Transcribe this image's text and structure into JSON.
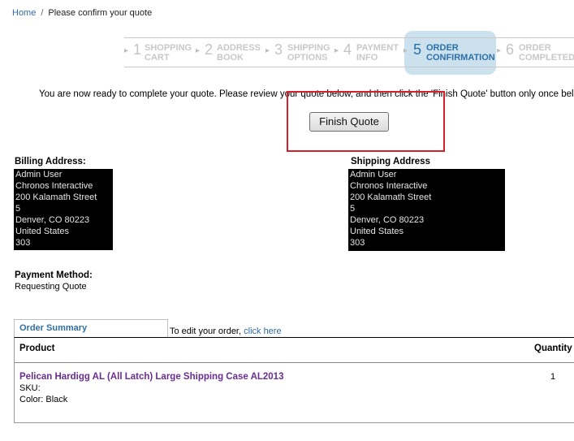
{
  "breadcrumb": {
    "home": "Home",
    "separator": "/",
    "current": "Please confirm your quote"
  },
  "steps": [
    {
      "num": "1",
      "line1": "SHOPPING",
      "line2": "CART"
    },
    {
      "num": "2",
      "line1": "ADDRESS",
      "line2": "BOOK"
    },
    {
      "num": "3",
      "line1": "SHIPPING",
      "line2": "OPTIONS"
    },
    {
      "num": "4",
      "line1": "PAYMENT",
      "line2": "INFO"
    },
    {
      "num": "5",
      "line1": "ORDER",
      "line2": "CONFIRMATION",
      "active": true
    },
    {
      "num": "6",
      "line1": "ORDER",
      "line2": "COMPLETED"
    }
  ],
  "intro_text": "You are now ready to complete your quote. Please review your quote below, and then click the 'Finish Quote' button only once below to p",
  "finish_button": "Finish Quote",
  "billing": {
    "title": "Billing Address:",
    "lines": [
      "Admin User",
      "Chronos Interactive",
      "200 Kalamath Street",
      "5",
      "Denver, CO 80223",
      "United States",
      "303"
    ]
  },
  "shipping": {
    "title": "Shipping Address",
    "lines": [
      "Admin User",
      "Chronos Interactive",
      "200 Kalamath Street",
      "5",
      "Denver, CO 80223",
      "United States",
      "303"
    ]
  },
  "payment": {
    "title": "Payment Method:",
    "value": "Requesting Quote"
  },
  "summary": {
    "tab": "Order Summary",
    "edit_prefix": "To edit your order,",
    "edit_link": "click here",
    "col_product": "Product",
    "col_quantity": "Quantity",
    "items": [
      {
        "name": "Pelican Hardigg AL (All Latch) Large Shipping Case AL2013",
        "sku": "SKU:",
        "color": "Color: Black",
        "qty": "1"
      }
    ]
  }
}
